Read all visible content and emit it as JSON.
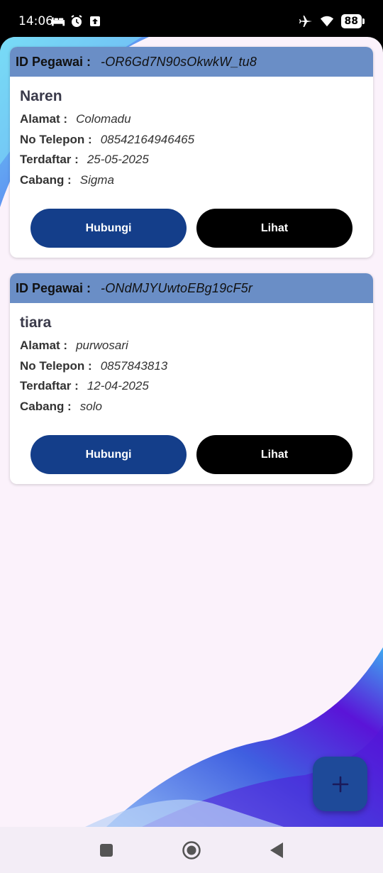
{
  "status_bar": {
    "time": "14:06",
    "battery": "88",
    "left_icons": [
      "bed-icon",
      "alarm-icon",
      "upload-icon"
    ],
    "right_icons": [
      "airplane-icon",
      "wifi-icon",
      "battery-icon"
    ]
  },
  "employees": [
    {
      "id_label": "ID Pegawai :",
      "id_value": "-OR6Gd7N90sOkwkW_tu8",
      "name": "Naren",
      "alamat_label": "Alamat :",
      "alamat": "Colomadu",
      "telepon_label": "No Telepon :",
      "telepon": "08542164946465",
      "terdaftar_label": "Terdaftar :",
      "terdaftar": "25-05-2025",
      "cabang_label": "Cabang :",
      "cabang": "Sigma",
      "contact_button": "Hubungi",
      "view_button": "Lihat"
    },
    {
      "id_label": "ID Pegawai :",
      "id_value": "-ONdMJYUwtoEBg19cF5r",
      "name": "tiara",
      "alamat_label": "Alamat :",
      "alamat": "purwosari",
      "telepon_label": "No Telepon :",
      "telepon": "0857843813",
      "terdaftar_label": "Terdaftar :",
      "terdaftar": "12-04-2025",
      "cabang_label": "Cabang :",
      "cabang": "solo",
      "contact_button": "Hubungi",
      "view_button": "Lihat"
    }
  ],
  "fab": {
    "icon": "plus-icon",
    "color": "#1e4a99"
  },
  "nav_bar": {
    "icons": [
      "recents-icon",
      "home-icon",
      "back-icon"
    ]
  },
  "colors": {
    "header": "#6a8ec6",
    "primary_button": "#143e8a",
    "secondary_button": "#000000",
    "background": "#fbf2fb"
  }
}
